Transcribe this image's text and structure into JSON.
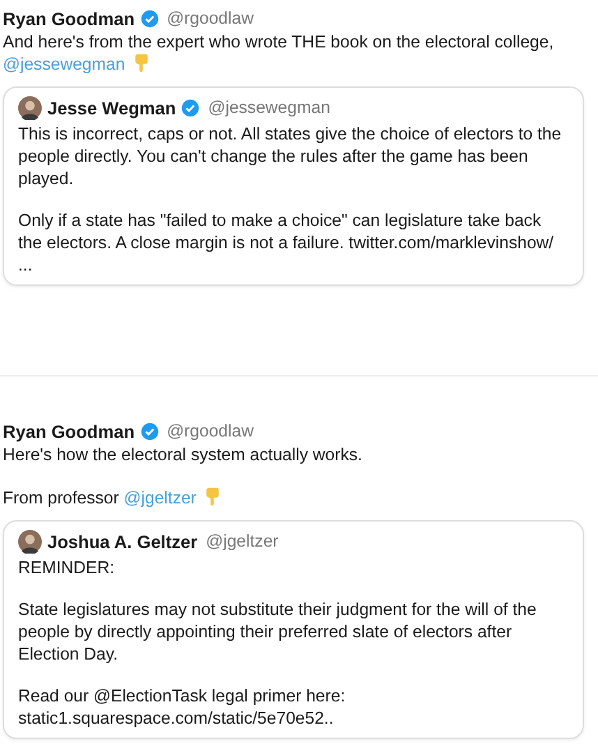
{
  "tweets": [
    {
      "author": {
        "name": "Ryan Goodman",
        "verified": true,
        "handle": "@rgoodlaw"
      },
      "paragraphs": [
        {
          "pointer": true,
          "segments": [
            {
              "kind": "plain",
              "text": "And here's from the expert who wrote THE book on the electoral college, "
            },
            {
              "kind": "mention",
              "text": "@jessewegman"
            }
          ]
        }
      ],
      "quote": {
        "author": {
          "name": "Jesse Wegman",
          "verified": true,
          "handle": "@jessewegman"
        },
        "paragraphs": [
          {
            "pointer": false,
            "segments": [
              {
                "kind": "plain",
                "text": "This is incorrect, caps or not. All states give the choice of electors to the people directly. You can't change the rules after the game has been played."
              }
            ]
          },
          {
            "pointer": false,
            "segments": [
              {
                "kind": "plain",
                "text": "Only if a state has \"failed to make a choice\" can legislature take back the electors. A close margin is not a failure. twitter.com/marklevinshow/\n..."
              }
            ]
          }
        ]
      }
    },
    {
      "author": {
        "name": "Ryan Goodman",
        "verified": true,
        "handle": "@rgoodlaw"
      },
      "paragraphs": [
        {
          "pointer": false,
          "segments": [
            {
              "kind": "plain",
              "text": "Here's how the electoral system actually works."
            }
          ]
        },
        {
          "pointer": true,
          "segments": [
            {
              "kind": "plain",
              "text": "From professor "
            },
            {
              "kind": "mention",
              "text": "@jgeltzer"
            }
          ]
        }
      ],
      "quote": {
        "author": {
          "name": "Joshua A. Geltzer",
          "verified": false,
          "handle": "@jgeltzer"
        },
        "paragraphs": [
          {
            "pointer": false,
            "segments": [
              {
                "kind": "plain",
                "text": "REMINDER:"
              }
            ]
          },
          {
            "pointer": false,
            "segments": [
              {
                "kind": "plain",
                "text": "State legislatures may not substitute their judgment for the will of the people by directly appointing their preferred slate of electors after Election Day."
              }
            ]
          },
          {
            "pointer": false,
            "segments": [
              {
                "kind": "plain",
                "text": "Read our @ElectionTask legal primer here:\nstatic1.squarespace.com/static/5e70e52.."
              }
            ]
          }
        ]
      }
    }
  ]
}
